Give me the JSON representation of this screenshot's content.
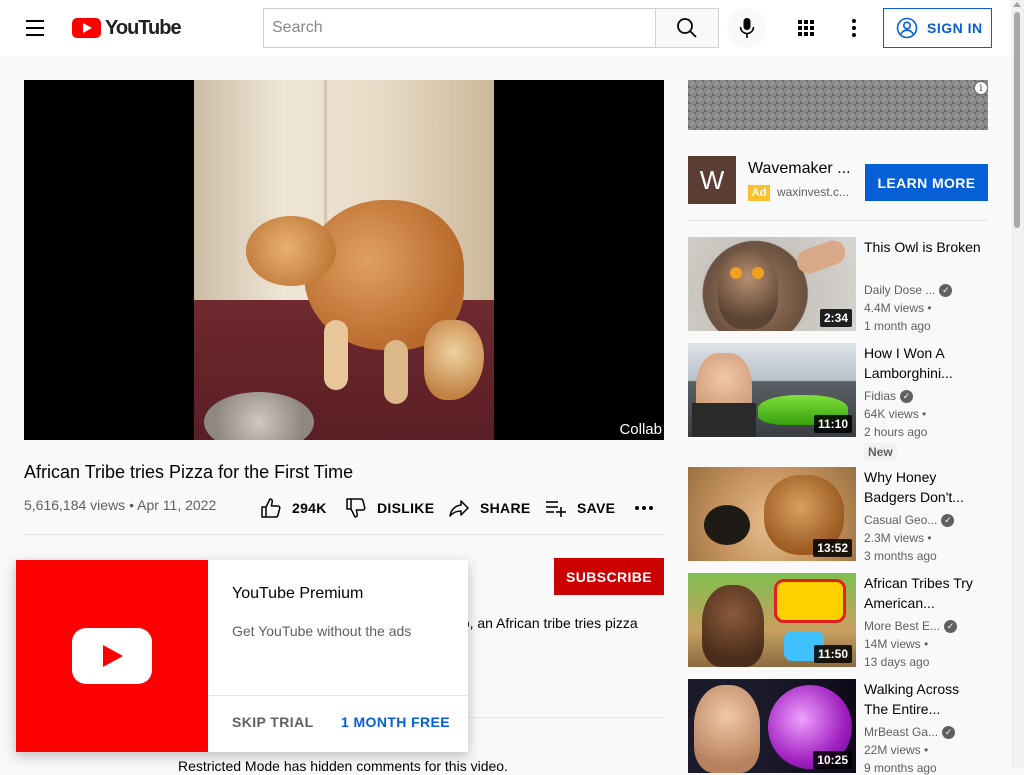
{
  "header": {
    "logo_text": "YouTube",
    "search_placeholder": "Search",
    "signin_label": "SIGN IN"
  },
  "player": {
    "badge": "Collab"
  },
  "video": {
    "title": "African Tribe tries Pizza for the First Time",
    "views": "5,616,184 views",
    "date": "Apr 11, 2022",
    "meta_separator": "•",
    "likes": "294K",
    "dislike_label": "DISLIKE",
    "share_label": "SHARE",
    "save_label": "SAVE",
    "subscribe_label": "SUBSCRIBE",
    "description_snippet": "eo, an African tribe tries pizza",
    "restricted_notice": "Restricted Mode has hidden comments for this video."
  },
  "premium_popup": {
    "title": "YouTube Premium",
    "subtitle": "Get YouTube without the ads",
    "skip_label": "SKIP TRIAL",
    "trial_label": "1 MONTH FREE"
  },
  "ad": {
    "logo_letter": "W",
    "name": "Wavemaker ...",
    "tag": "Ad",
    "domain": "waxinvest.c...",
    "cta_label": "LEARN MORE",
    "info_glyph": "i"
  },
  "recommendations": [
    {
      "title": "This Owl is Broken",
      "channel": "Daily Dose ...",
      "verified": true,
      "views": "4.4M views •",
      "age": "1 month ago",
      "duration": "2:34",
      "badge": ""
    },
    {
      "title": "How I Won A Lamborghini...",
      "channel": "Fidias",
      "verified": true,
      "views": "64K views •",
      "age": "2 hours ago",
      "duration": "11:10",
      "badge": "New"
    },
    {
      "title": "Why Honey Badgers Don't...",
      "channel": "Casual Geo...",
      "verified": true,
      "views": "2.3M views •",
      "age": "3 months ago",
      "duration": "13:52",
      "badge": ""
    },
    {
      "title": "African Tribes Try American...",
      "channel": "More Best E...",
      "verified": true,
      "views": "14M views •",
      "age": "13 days ago",
      "duration": "11:50",
      "badge": ""
    },
    {
      "title": "Walking Across The Entire...",
      "channel": "MrBeast Ga...",
      "verified": true,
      "views": "22M views •",
      "age": "9 months ago",
      "duration": "10:25",
      "badge": ""
    }
  ],
  "colors": {
    "brand_red": "#ff0000",
    "subscribe_red": "#cc0000",
    "link_blue": "#065fd4"
  }
}
